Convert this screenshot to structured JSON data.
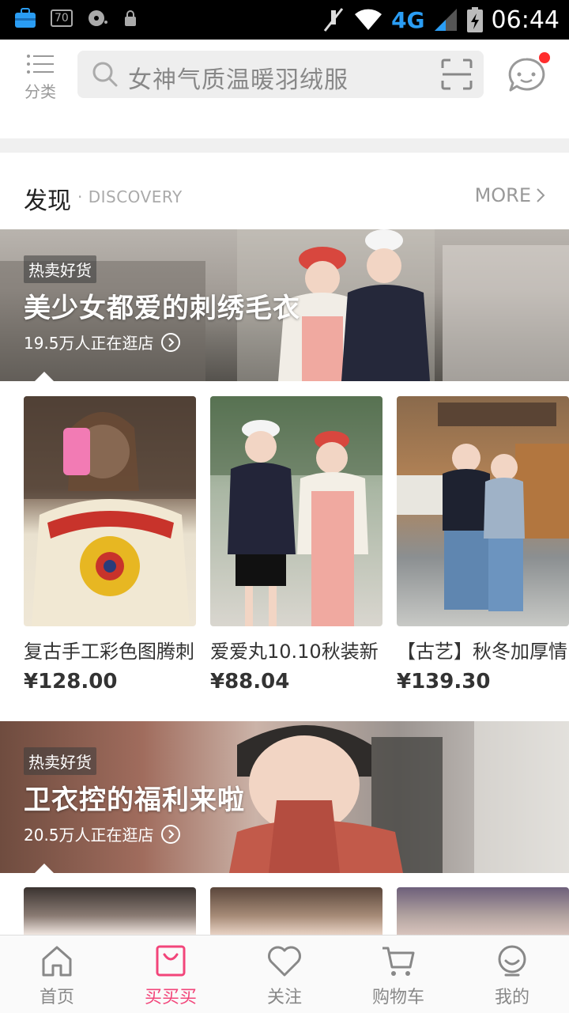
{
  "status_bar": {
    "badge": "70",
    "network": "4G",
    "time": "06:44"
  },
  "header": {
    "category_label": "分类",
    "search_placeholder": "女神气质温暖羽绒服",
    "message_has_unread": true
  },
  "discovery": {
    "title": "发现",
    "subtitle": "· DISCOVERY",
    "more_label": "MORE"
  },
  "sections": [
    {
      "tag": "热卖好货",
      "title": "美少女都爱的刺绣毛衣",
      "visitors": "19.5万人正在逛店",
      "products": [
        {
          "name": "复古手工彩色图腾刺",
          "price": "¥128.00"
        },
        {
          "name": "爱爱丸10.10秋装新",
          "price": "¥88.04"
        },
        {
          "name": "【古艺】秋冬加厚情",
          "price": "¥139.30"
        }
      ]
    },
    {
      "tag": "热卖好货",
      "title": "卫衣控的福利来啦",
      "visitors": "20.5万人正在逛店"
    }
  ],
  "bottom_nav": [
    {
      "label": "首页",
      "icon": "home-icon",
      "active": false
    },
    {
      "label": "买买买",
      "icon": "shopping-bag-icon",
      "active": true
    },
    {
      "label": "关注",
      "icon": "heart-icon",
      "active": false
    },
    {
      "label": "购物车",
      "icon": "cart-icon",
      "active": false
    },
    {
      "label": "我的",
      "icon": "profile-icon",
      "active": false
    }
  ],
  "colors": {
    "accent": "#f2457a",
    "notification_dot": "#ff2d2d",
    "network_4g": "#2a9df4"
  }
}
